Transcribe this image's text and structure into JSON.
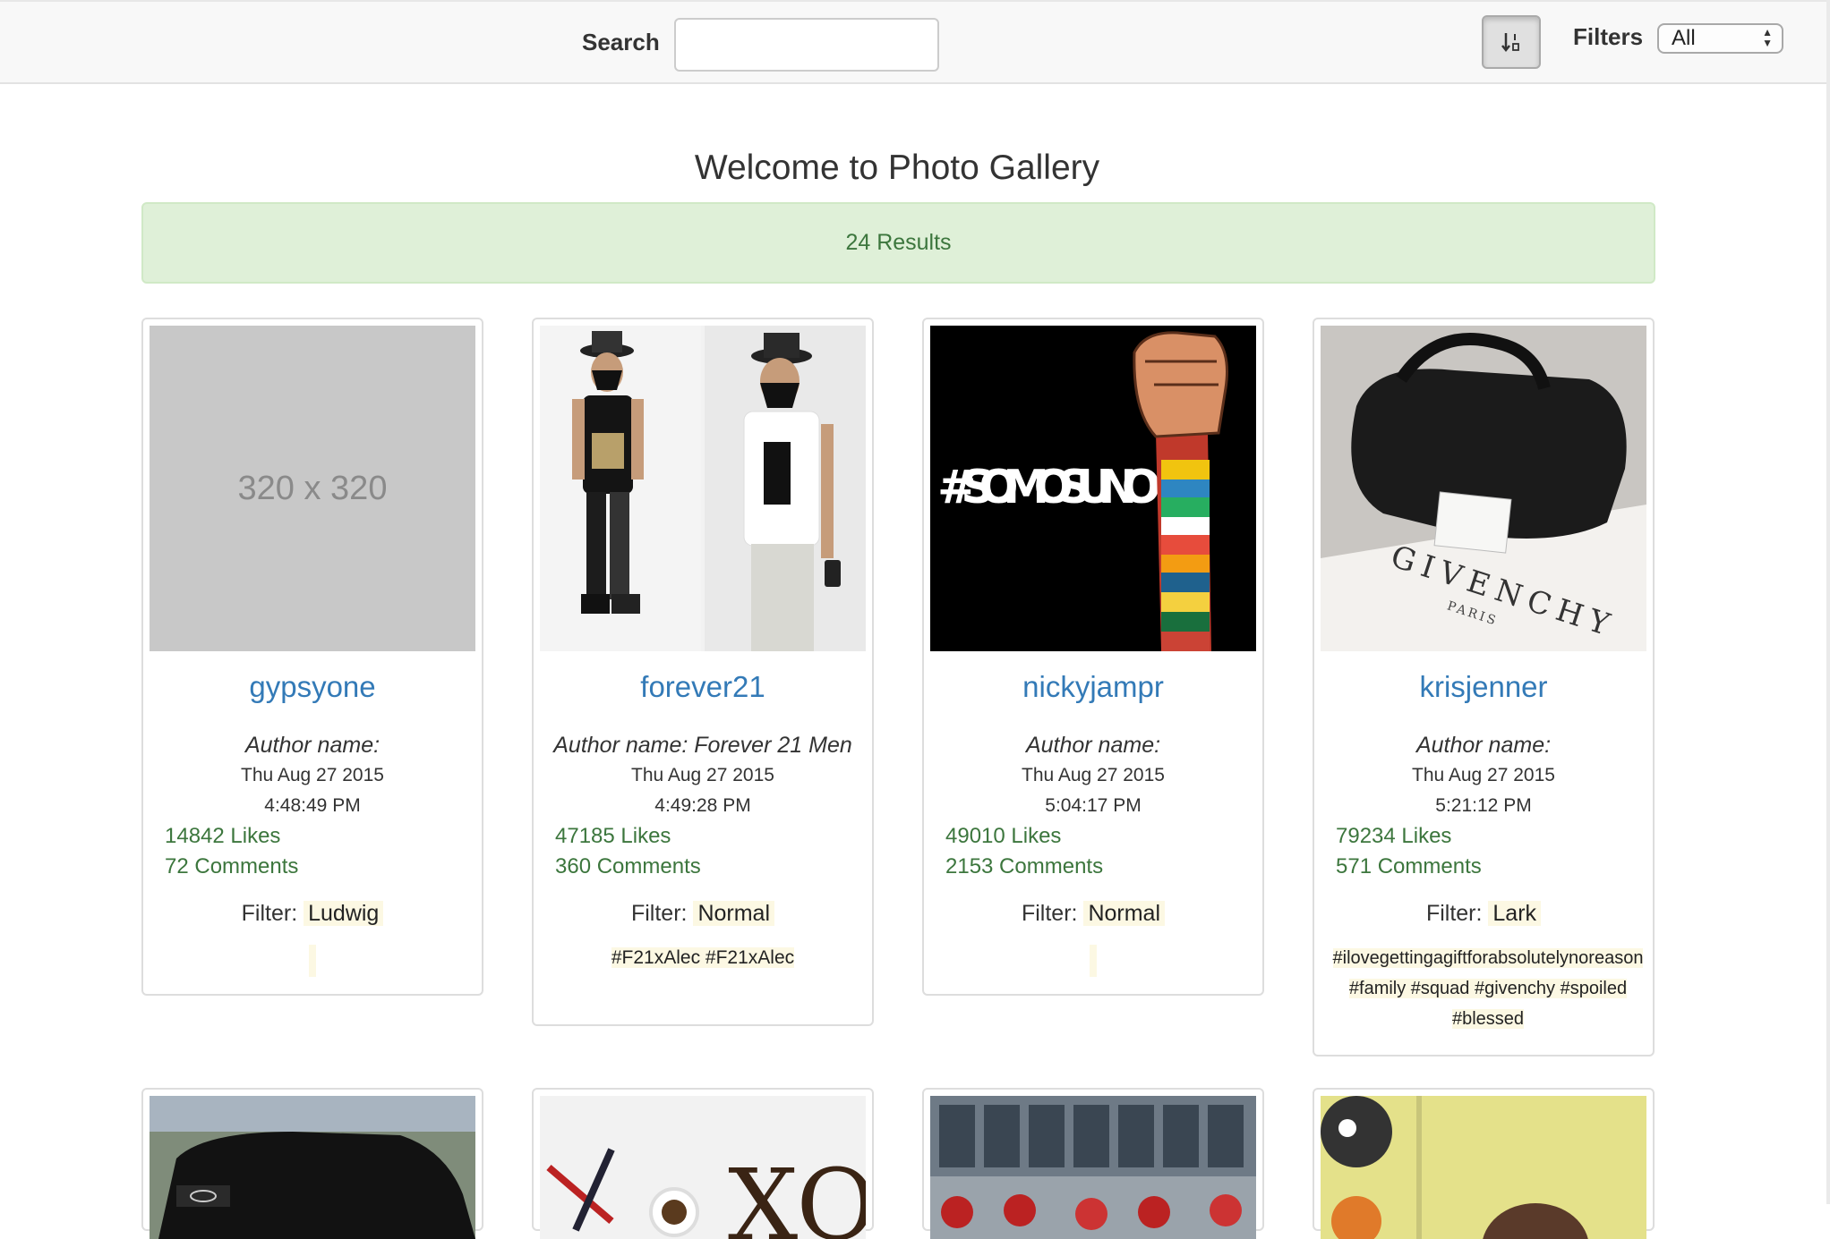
{
  "toolbar": {
    "search_label": "Search",
    "search_value": "",
    "filters_label": "Filters",
    "filters_selected": "All"
  },
  "header": {
    "title": "Welcome to Photo Gallery",
    "results": "24 Results"
  },
  "cards": [
    {
      "username": "gypsyone",
      "author": "Author name:",
      "date": "Thu Aug 27 2015",
      "time": "4:48:49 PM",
      "likes": "14842 Likes",
      "comments": "72 Comments",
      "filter_label": "Filter:",
      "filter": "Ludwig",
      "tags": "",
      "placeholder_text": "320 x 320"
    },
    {
      "username": "forever21",
      "author": "Author name: Forever 21 Men",
      "date": "Thu Aug 27 2015",
      "time": "4:49:28 PM",
      "likes": "47185 Likes",
      "comments": "360 Comments",
      "filter_label": "Filter:",
      "filter": "Normal",
      "tags": "#F21xAlec #F21xAlec"
    },
    {
      "username": "nickyjampr",
      "author": "Author name:",
      "date": "Thu Aug 27 2015",
      "time": "5:04:17 PM",
      "likes": "49010 Likes",
      "comments": "2153 Comments",
      "filter_label": "Filter:",
      "filter": "Normal",
      "tags": "",
      "image_text": "#SOMOSUNO"
    },
    {
      "username": "krisjenner",
      "author": "Author name:",
      "date": "Thu Aug 27 2015",
      "time": "5:21:12 PM",
      "likes": "79234 Likes",
      "comments": "571 Comments",
      "filter_label": "Filter:",
      "filter": "Lark",
      "tags_line1": "#ilovegettingagiftforabsolutelynoreason",
      "tags_line2": "#family #squad #givenchy #spoiled",
      "tags_line3": "#blessed",
      "image_text": "GIVENCHY",
      "image_subtext": "PARIS"
    }
  ],
  "colors": {
    "link": "#337ab7",
    "success_text": "#3c763d",
    "success_bg": "#dff0d8",
    "highlight": "#fcf8e3"
  }
}
